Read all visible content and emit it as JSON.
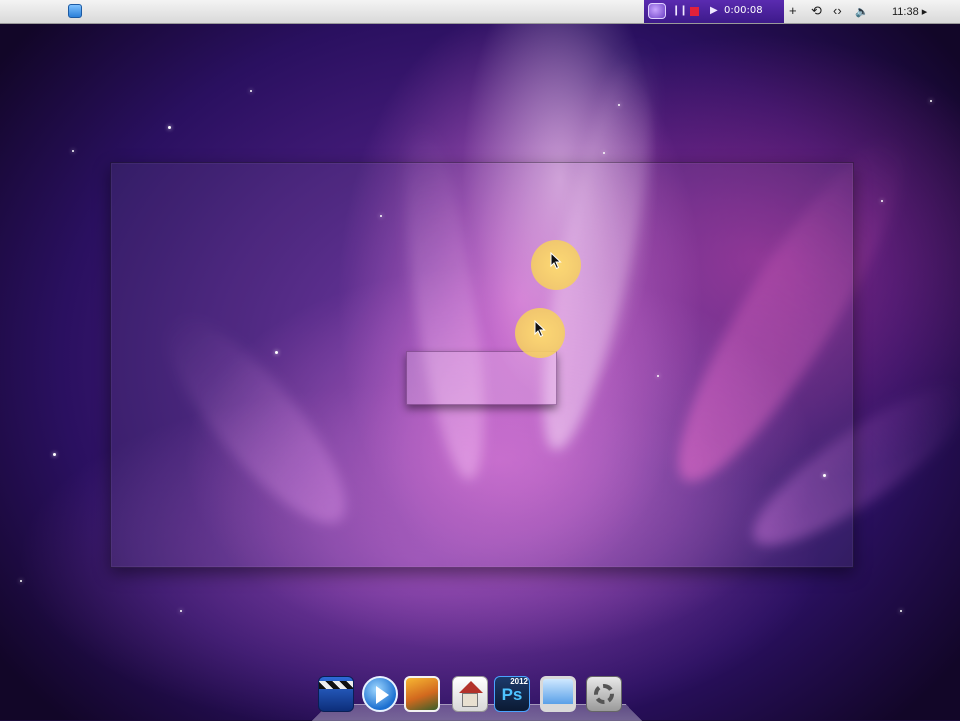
{
  "menubar": {
    "apple_glyph": "",
    "recorder": {
      "pause_glyph": "❙❙",
      "play_glyph": "▶",
      "time": "0:00:08"
    },
    "add_glyph": "+",
    "timemachine_glyph": "⟲",
    "nav_glyph": "‹›",
    "volume_glyph": "🔈",
    "clock": "11:38 ▸"
  },
  "dock": {
    "ps_label": "Ps",
    "ps_badge": "2012"
  },
  "colors": {
    "recorder_bg": "#4b23a0",
    "record_stop": "#e2213a",
    "cursor_highlight": "#f4d070",
    "wallpaper_accent": "#d468d0"
  },
  "icons": [
    "apple-icon",
    "app-icon",
    "recorder-logo-icon",
    "pause-icon",
    "stop-icon",
    "play-icon",
    "add-icon",
    "time-machine-icon",
    "navigate-icon",
    "volume-icon",
    "clapperboard-icon",
    "media-play-icon",
    "photo-icon",
    "home-icon",
    "photoshop-icon",
    "monitor-icon",
    "settings-icon"
  ]
}
